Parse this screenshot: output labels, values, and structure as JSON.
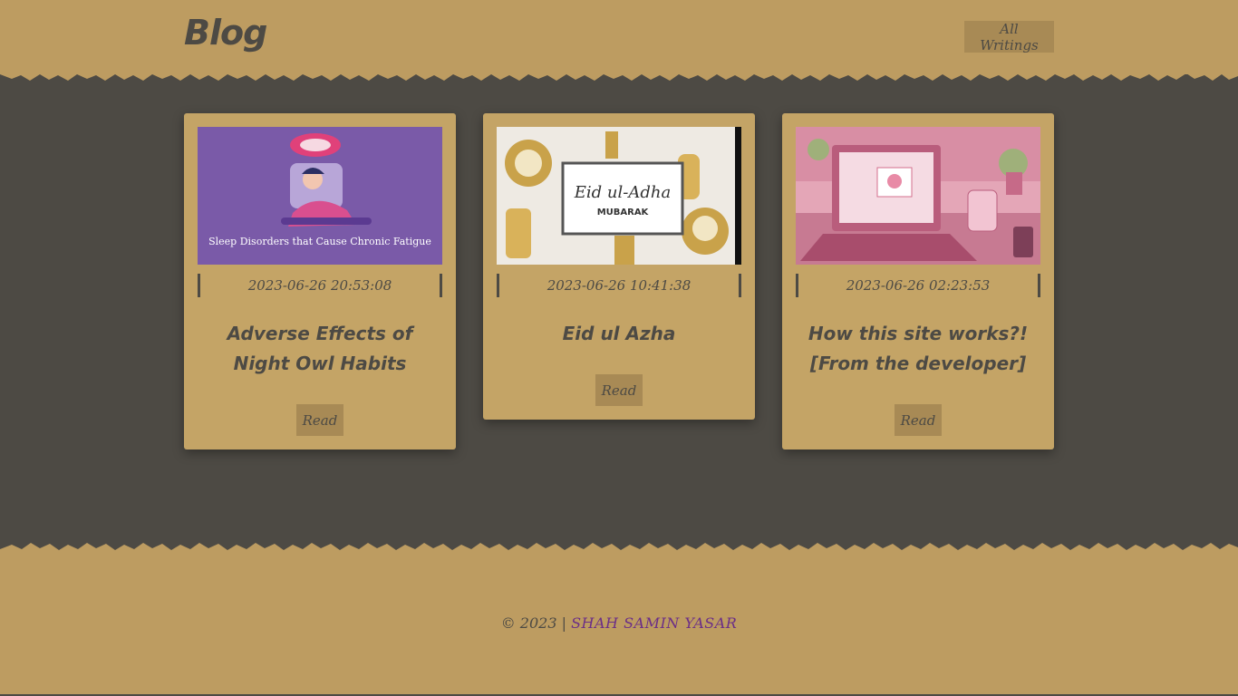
{
  "header": {
    "title": "Blog",
    "all_writings_label": "All Writings"
  },
  "posts": [
    {
      "image_caption": "Sleep Disorders that Cause Chronic Fatigue",
      "date": "2023-06-26 20:53:08",
      "title": "Adverse Effects of Night Owl Habits",
      "read_label": "Read"
    },
    {
      "image_caption": "Eid ul-Adha",
      "image_subcaption": "MUBARAK",
      "date": "2023-06-26 10:41:38",
      "title": "Eid ul Azha",
      "read_label": "Read"
    },
    {
      "date": "2023-06-26 02:23:53",
      "title": "How this site works?! [From the developer]",
      "read_label": "Read"
    }
  ],
  "footer": {
    "copyright": "© 2023 |",
    "author": "SHAH SAMIN YASAR"
  },
  "colors": {
    "header_bg": "#bd9c61",
    "page_bg": "#4d4a44",
    "card_bg": "#c4a466",
    "button_bg": "#a88a55",
    "author_link": "#6b2e87"
  }
}
